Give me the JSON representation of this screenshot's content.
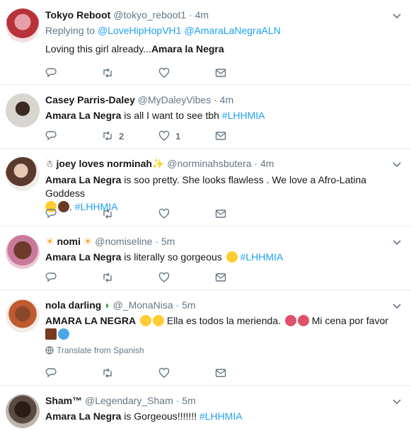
{
  "tweets": [
    {
      "name": "Tokyo Reboot",
      "handle": "@tokyo_reboot1",
      "time": "4m",
      "replying_prefix": "Replying to",
      "replying_to": [
        "@LoveHipHopVH1",
        "@AmaraLaNegraALN"
      ],
      "text_plain": "Loving this girl already...",
      "text_bold": "Amara la Negra",
      "retweets": "",
      "likes": ""
    },
    {
      "name": "Casey Parris-Daley",
      "handle": "@MyDaleyVibes",
      "time": "4m",
      "text_bold": "Amara La Negra",
      "text_plain": " is all I want to see tbh ",
      "hashtag": "#LHHMIA",
      "retweets": "2",
      "likes": "1"
    },
    {
      "name": "joey loves norminah",
      "name_prefix_icon": "snowman-icon",
      "name_suffix_icon": "sparkle-icon",
      "handle": "@norminahsbutera",
      "time": "4m",
      "text_bold": "Amara La Negra",
      "text_plain": " is soo pretty. She looks flawless . We love a Afro-Latina Goddess",
      "hashtag": "#LHHMIA"
    },
    {
      "name": "nomi",
      "name_icon": "sun-icon",
      "handle": "@nomiseline",
      "time": "5m",
      "text_bold": "Amara La Negra",
      "text_plain": " is literally so gorgeous ",
      "hashtag": "#LHHMIA"
    },
    {
      "name": "nola darling",
      "name_icon": "watermelon-icon",
      "handle": "@_MonaNisa",
      "time": "5m",
      "text_bold": "AMARA LA NEGRA",
      "text_plain": " Ella es todos la merienda.",
      "text_plain2": " Mi cena por favor",
      "translate": "Translate from Spanish"
    },
    {
      "name": "Sham™",
      "handle": "@Legendary_Sham",
      "time": "5m",
      "text_bold": "Amara La Negra",
      "text_plain": " is Gorgeous!!!!!!! ",
      "hashtag": "#LHHMIA"
    }
  ],
  "separator": "·",
  "colors": {
    "link": "#1da1f2",
    "muted": "#657786",
    "border": "#e6ecf0",
    "text": "#14171a"
  }
}
